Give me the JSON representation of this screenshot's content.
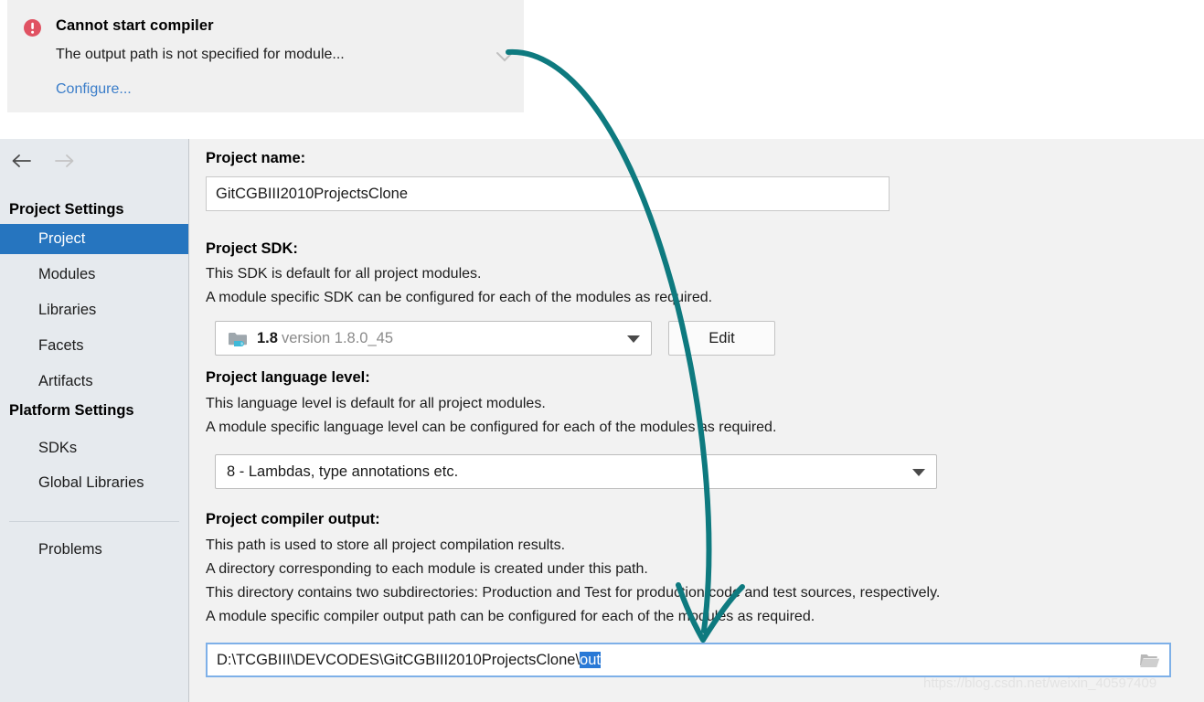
{
  "notification": {
    "icon": "error-circle-icon",
    "title": "Cannot start compiler",
    "message": "The output path is not specified for module...",
    "link": "Configure...",
    "collapse_icon": "chevron-down-icon"
  },
  "sidebar": {
    "nav": {
      "back_icon": "arrow-left-icon",
      "forward_icon": "arrow-right-icon"
    },
    "groups": [
      {
        "label": "Project Settings",
        "items": [
          {
            "label": "Project",
            "selected": true
          },
          {
            "label": "Modules",
            "selected": false
          },
          {
            "label": "Libraries",
            "selected": false
          },
          {
            "label": "Facets",
            "selected": false
          },
          {
            "label": "Artifacts",
            "selected": false
          }
        ]
      },
      {
        "label": "Platform Settings",
        "items": [
          {
            "label": "SDKs",
            "selected": false
          },
          {
            "label": "Global Libraries",
            "selected": false
          }
        ]
      }
    ],
    "extra_items": [
      {
        "label": "Problems",
        "selected": false
      }
    ]
  },
  "main": {
    "project_name": {
      "label": "Project name:",
      "value": "GitCGBIII2010ProjectsClone"
    },
    "project_sdk": {
      "label": "Project SDK:",
      "desc_line1": "This SDK is default for all project modules.",
      "desc_line2": "A module specific SDK can be configured for each of the modules as required.",
      "icon": "java-sdk-folder-icon",
      "version_short": "1.8",
      "version_full": "version 1.8.0_45",
      "edit_button": "Edit"
    },
    "language_level": {
      "label": "Project language level:",
      "desc_line1": "This language level is default for all project modules.",
      "desc_line2": "A module specific language level can be configured for each of the modules as required.",
      "value": "8 - Lambdas, type annotations etc."
    },
    "compiler_output": {
      "label": "Project compiler output:",
      "desc_line1": "This path is used to store all project compilation results.",
      "desc_line2": "A directory corresponding to each module is created under this path.",
      "desc_line3": "This directory contains two subdirectories: Production and Test for production code and test sources, respectively.",
      "desc_line4": "A module specific compiler output path can be configured for each of the modules as required.",
      "path_prefix": "D:\\TCGBIII\\DEVCODES\\GitCGBIII2010ProjectsClone\\",
      "path_selected": "out",
      "browse_icon": "folder-open-icon"
    }
  },
  "annotation": {
    "arrow_color": "#0e7a7f",
    "description": "curved arrow from notification to output path field"
  },
  "watermark": {
    "text": "https://blog.csdn.net/weixin_40597409"
  },
  "colors": {
    "accent_blue": "#2675bf",
    "selection_blue": "#2979d6",
    "link_blue": "#3a7dc9",
    "error_red": "#e05262",
    "sidebar_bg": "#e6eaee",
    "panel_bg": "#f2f2f2",
    "notification_bg": "#f0f0f0",
    "annotation_teal": "#0e7a7f"
  }
}
